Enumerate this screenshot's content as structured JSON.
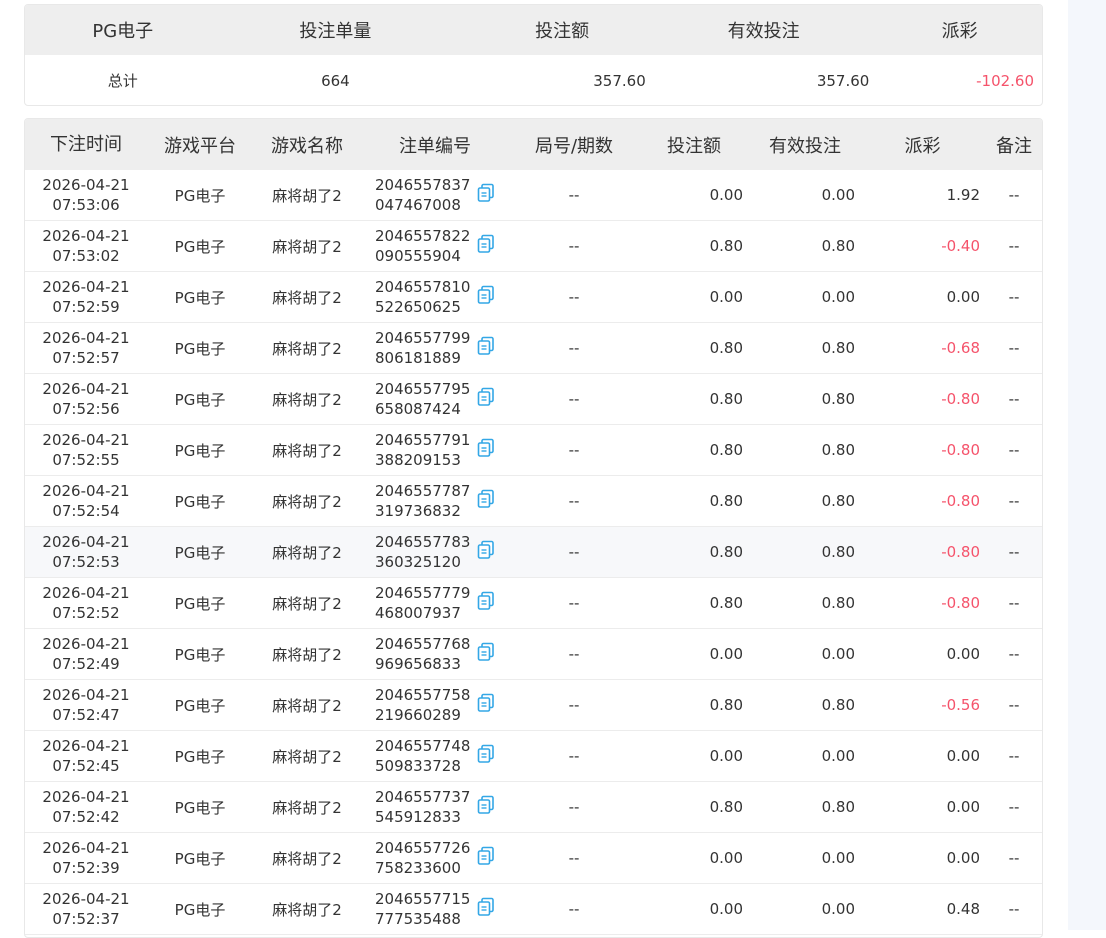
{
  "summary": {
    "headers": [
      "PG电子",
      "投注单量",
      "投注额",
      "有效投注",
      "派彩"
    ],
    "row": {
      "label": "总计",
      "count": "664",
      "bet": "357.60",
      "valid": "357.60",
      "payout": "-102.60"
    }
  },
  "table": {
    "headers": [
      "下注时间",
      "游戏平台",
      "游戏名称",
      "注单编号",
      "局号/期数",
      "投注额",
      "有效投注",
      "派彩",
      "备注"
    ],
    "rows": [
      {
        "date": "2026-04-21",
        "time": "07:53:06",
        "platform": "PG电子",
        "game": "麻将胡了2",
        "order1": "2046557837",
        "order2": "047467008",
        "round": "--",
        "bet": "0.00",
        "valid": "0.00",
        "payout": "1.92",
        "note": "--",
        "neg": false
      },
      {
        "date": "2026-04-21",
        "time": "07:53:02",
        "platform": "PG电子",
        "game": "麻将胡了2",
        "order1": "2046557822",
        "order2": "090555904",
        "round": "--",
        "bet": "0.80",
        "valid": "0.80",
        "payout": "-0.40",
        "note": "--",
        "neg": true
      },
      {
        "date": "2026-04-21",
        "time": "07:52:59",
        "platform": "PG电子",
        "game": "麻将胡了2",
        "order1": "2046557810",
        "order2": "522650625",
        "round": "--",
        "bet": "0.00",
        "valid": "0.00",
        "payout": "0.00",
        "note": "--",
        "neg": false
      },
      {
        "date": "2026-04-21",
        "time": "07:52:57",
        "platform": "PG电子",
        "game": "麻将胡了2",
        "order1": "2046557799",
        "order2": "806181889",
        "round": "--",
        "bet": "0.80",
        "valid": "0.80",
        "payout": "-0.68",
        "note": "--",
        "neg": true
      },
      {
        "date": "2026-04-21",
        "time": "07:52:56",
        "platform": "PG电子",
        "game": "麻将胡了2",
        "order1": "2046557795",
        "order2": "658087424",
        "round": "--",
        "bet": "0.80",
        "valid": "0.80",
        "payout": "-0.80",
        "note": "--",
        "neg": true
      },
      {
        "date": "2026-04-21",
        "time": "07:52:55",
        "platform": "PG电子",
        "game": "麻将胡了2",
        "order1": "2046557791",
        "order2": "388209153",
        "round": "--",
        "bet": "0.80",
        "valid": "0.80",
        "payout": "-0.80",
        "note": "--",
        "neg": true
      },
      {
        "date": "2026-04-21",
        "time": "07:52:54",
        "platform": "PG电子",
        "game": "麻将胡了2",
        "order1": "2046557787",
        "order2": "319736832",
        "round": "--",
        "bet": "0.80",
        "valid": "0.80",
        "payout": "-0.80",
        "note": "--",
        "neg": true
      },
      {
        "date": "2026-04-21",
        "time": "07:52:53",
        "platform": "PG电子",
        "game": "麻将胡了2",
        "order1": "2046557783",
        "order2": "360325120",
        "round": "--",
        "bet": "0.80",
        "valid": "0.80",
        "payout": "-0.80",
        "note": "--",
        "neg": true
      },
      {
        "date": "2026-04-21",
        "time": "07:52:52",
        "platform": "PG电子",
        "game": "麻将胡了2",
        "order1": "2046557779",
        "order2": "468007937",
        "round": "--",
        "bet": "0.80",
        "valid": "0.80",
        "payout": "-0.80",
        "note": "--",
        "neg": true
      },
      {
        "date": "2026-04-21",
        "time": "07:52:49",
        "platform": "PG电子",
        "game": "麻将胡了2",
        "order1": "2046557768",
        "order2": "969656833",
        "round": "--",
        "bet": "0.00",
        "valid": "0.00",
        "payout": "0.00",
        "note": "--",
        "neg": false
      },
      {
        "date": "2026-04-21",
        "time": "07:52:47",
        "platform": "PG电子",
        "game": "麻将胡了2",
        "order1": "2046557758",
        "order2": "219660289",
        "round": "--",
        "bet": "0.80",
        "valid": "0.80",
        "payout": "-0.56",
        "note": "--",
        "neg": true
      },
      {
        "date": "2026-04-21",
        "time": "07:52:45",
        "platform": "PG电子",
        "game": "麻将胡了2",
        "order1": "2046557748",
        "order2": "509833728",
        "round": "--",
        "bet": "0.00",
        "valid": "0.00",
        "payout": "0.00",
        "note": "--",
        "neg": false
      },
      {
        "date": "2026-04-21",
        "time": "07:52:42",
        "platform": "PG电子",
        "game": "麻将胡了2",
        "order1": "2046557737",
        "order2": "545912833",
        "round": "--",
        "bet": "0.80",
        "valid": "0.80",
        "payout": "0.00",
        "note": "--",
        "neg": false
      },
      {
        "date": "2026-04-21",
        "time": "07:52:39",
        "platform": "PG电子",
        "game": "麻将胡了2",
        "order1": "2046557726",
        "order2": "758233600",
        "round": "--",
        "bet": "0.00",
        "valid": "0.00",
        "payout": "0.00",
        "note": "--",
        "neg": false
      },
      {
        "date": "2026-04-21",
        "time": "07:52:37",
        "platform": "PG电子",
        "game": "麻将胡了2",
        "order1": "2046557715",
        "order2": "777535488",
        "round": "--",
        "bet": "0.00",
        "valid": "0.00",
        "payout": "0.48",
        "note": "--",
        "neg": false
      }
    ]
  },
  "colors": {
    "negative": "#f5536b",
    "header_bg": "#eeeeee",
    "icon": "#33a7e6"
  },
  "icons": {
    "copy": "copy-icon"
  }
}
